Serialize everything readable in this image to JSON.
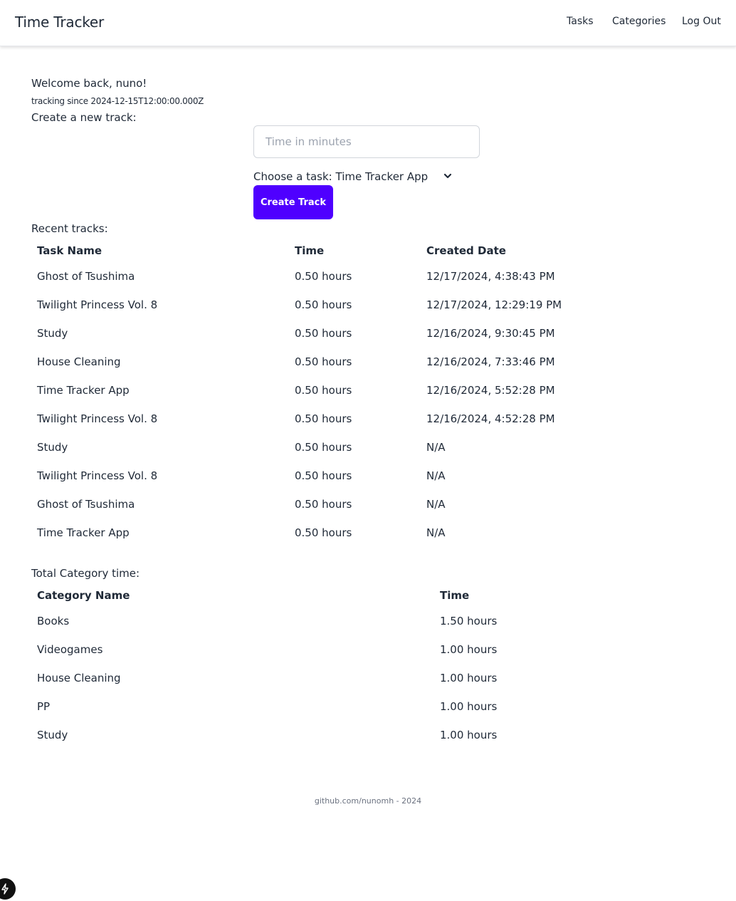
{
  "app": {
    "title": "Time Tracker"
  },
  "nav": {
    "tasks": "Tasks",
    "categories": "Categories",
    "logout": "Log Out"
  },
  "welcome": {
    "greeting": "Welcome back, nuno!",
    "since": "tracking since 2024-12-15T12:00:00.000Z"
  },
  "create": {
    "label": "Create a new track:",
    "time_placeholder": "Time in minutes",
    "task_select": "Choose a task: Time Tracker App",
    "button": "Create Track"
  },
  "recent": {
    "label": "Recent tracks:",
    "headers": {
      "task": "Task Name",
      "time": "Time",
      "created": "Created Date"
    },
    "rows": [
      {
        "task": "Ghost of Tsushima",
        "time": "0.50 hours",
        "created": "12/17/2024, 4:38:43 PM"
      },
      {
        "task": "Twilight Princess Vol. 8",
        "time": "0.50 hours",
        "created": "12/17/2024, 12:29:19 PM"
      },
      {
        "task": "Study",
        "time": "0.50 hours",
        "created": "12/16/2024, 9:30:45 PM"
      },
      {
        "task": "House Cleaning",
        "time": "0.50 hours",
        "created": "12/16/2024, 7:33:46 PM"
      },
      {
        "task": "Time Tracker App",
        "time": "0.50 hours",
        "created": "12/16/2024, 5:52:28 PM"
      },
      {
        "task": "Twilight Princess Vol. 8",
        "time": "0.50 hours",
        "created": "12/16/2024, 4:52:28 PM"
      },
      {
        "task": "Study",
        "time": "0.50 hours",
        "created": "N/A"
      },
      {
        "task": "Twilight Princess Vol. 8",
        "time": "0.50 hours",
        "created": "N/A"
      },
      {
        "task": "Ghost of Tsushima",
        "time": "0.50 hours",
        "created": "N/A"
      },
      {
        "task": "Time Tracker App",
        "time": "0.50 hours",
        "created": "N/A"
      }
    ]
  },
  "categories": {
    "label": "Total Category time:",
    "headers": {
      "name": "Category Name",
      "time": "Time"
    },
    "rows": [
      {
        "name": "Books",
        "time": "1.50 hours"
      },
      {
        "name": "Videogames",
        "time": "1.00 hours"
      },
      {
        "name": "House Cleaning",
        "time": "1.00 hours"
      },
      {
        "name": "PP",
        "time": "1.00 hours"
      },
      {
        "name": "Study",
        "time": "1.00 hours"
      }
    ]
  },
  "footer": {
    "text": "github.com/nunomh - 2024"
  },
  "colors": {
    "accent": "#4f00ff"
  },
  "icons": {
    "select": "chevron-down-icon",
    "badge": "lightning-icon"
  }
}
